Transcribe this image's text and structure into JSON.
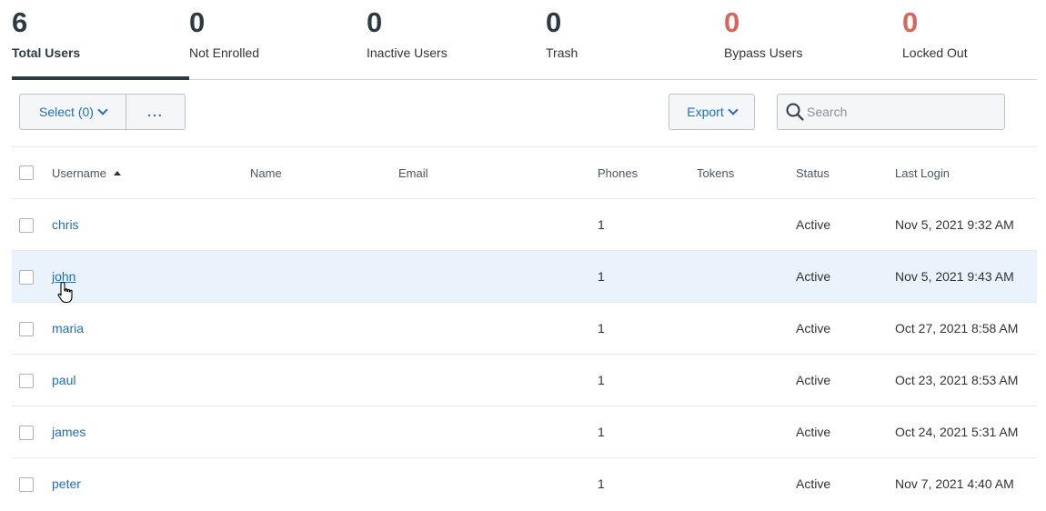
{
  "stats": [
    {
      "value": "6",
      "label": "Total Users"
    },
    {
      "value": "0",
      "label": "Not Enrolled"
    },
    {
      "value": "0",
      "label": "Inactive Users"
    },
    {
      "value": "0",
      "label": "Trash"
    },
    {
      "value": "0",
      "label": "Bypass Users"
    },
    {
      "value": "0",
      "label": "Locked Out"
    }
  ],
  "toolbar": {
    "select_label": "Select (0)",
    "more_label": "...",
    "export_label": "Export",
    "search_placeholder": "Search"
  },
  "table": {
    "columns": [
      "Username",
      "Name",
      "Email",
      "Phones",
      "Tokens",
      "Status",
      "Last Login"
    ],
    "rows": [
      {
        "username": "chris",
        "name": "",
        "email": "",
        "phones": "1",
        "tokens": "",
        "status": "Active",
        "last_login": "Nov 5, 2021 9:32 AM"
      },
      {
        "username": "john",
        "name": "",
        "email": "",
        "phones": "1",
        "tokens": "",
        "status": "Active",
        "last_login": "Nov 5, 2021 9:43 AM"
      },
      {
        "username": "maria",
        "name": "",
        "email": "",
        "phones": "1",
        "tokens": "",
        "status": "Active",
        "last_login": "Oct 27, 2021 8:58 AM"
      },
      {
        "username": "paul",
        "name": "",
        "email": "",
        "phones": "1",
        "tokens": "",
        "status": "Active",
        "last_login": "Oct 23, 2021 8:53 AM"
      },
      {
        "username": "james",
        "name": "",
        "email": "",
        "phones": "1",
        "tokens": "",
        "status": "Active",
        "last_login": "Oct 24, 2021 5:31 AM"
      },
      {
        "username": "peter",
        "name": "",
        "email": "",
        "phones": "1",
        "tokens": "",
        "status": "Active",
        "last_login": "Nov 7, 2021 4:40 AM"
      }
    ]
  },
  "colors": {
    "accent": "#1e6fbf",
    "alert": "#d9655a",
    "dark": "#2c3a46",
    "row_highlight": "#eaf3fb"
  }
}
